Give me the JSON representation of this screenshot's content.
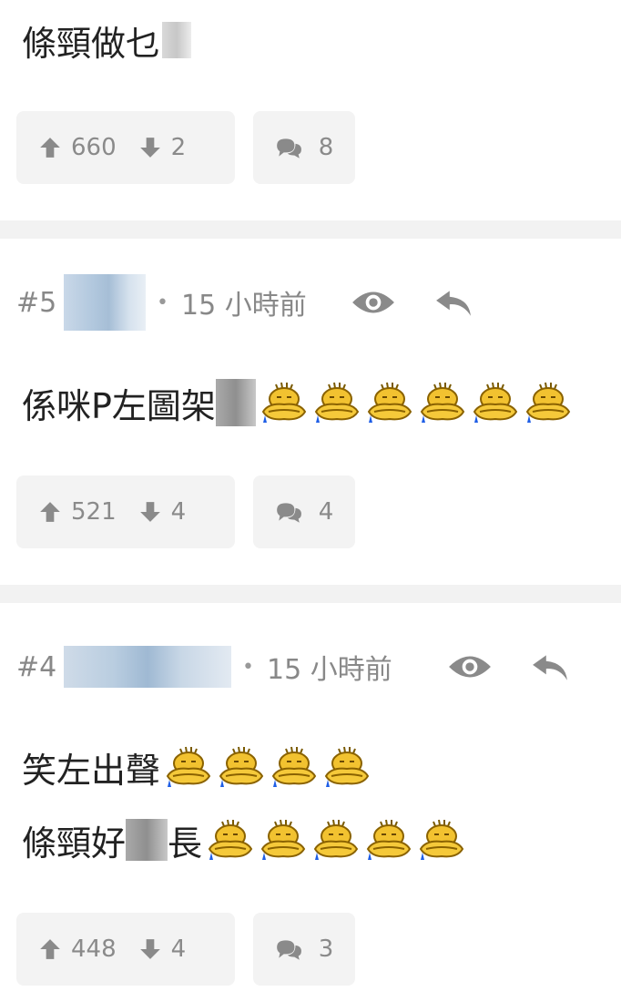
{
  "post_top": {
    "text": "條頸做乜",
    "upvotes": "660",
    "downvotes": "2",
    "comments": "8"
  },
  "post5": {
    "number": "#5",
    "time": "15 小時前",
    "text_before": "係咪P左圖架",
    "emoji_count": 6,
    "upvotes": "521",
    "downvotes": "4",
    "comments": "4"
  },
  "post4": {
    "number": "#4",
    "time": "15 小時前",
    "line1": "笑左出聲",
    "line1_emoji_count": 4,
    "line2_a": "條頸好",
    "line2_b": "長",
    "line2_emoji_count": 5,
    "upvotes": "448",
    "downvotes": "4",
    "comments": "3"
  },
  "icons": {
    "view": "eye-icon",
    "reply": "reply-arrow-icon",
    "upvote": "arrow-up-icon",
    "downvote": "arrow-down-icon",
    "comment": "speech-bubbles-icon",
    "emoji": "sweating-face-emoji"
  },
  "colors": {
    "background": "#ffffff",
    "separator": "#f2f2f2",
    "meta_text": "#888888",
    "button_bg": "#f3f3f3",
    "emoji_yellow": "#f2c230"
  }
}
